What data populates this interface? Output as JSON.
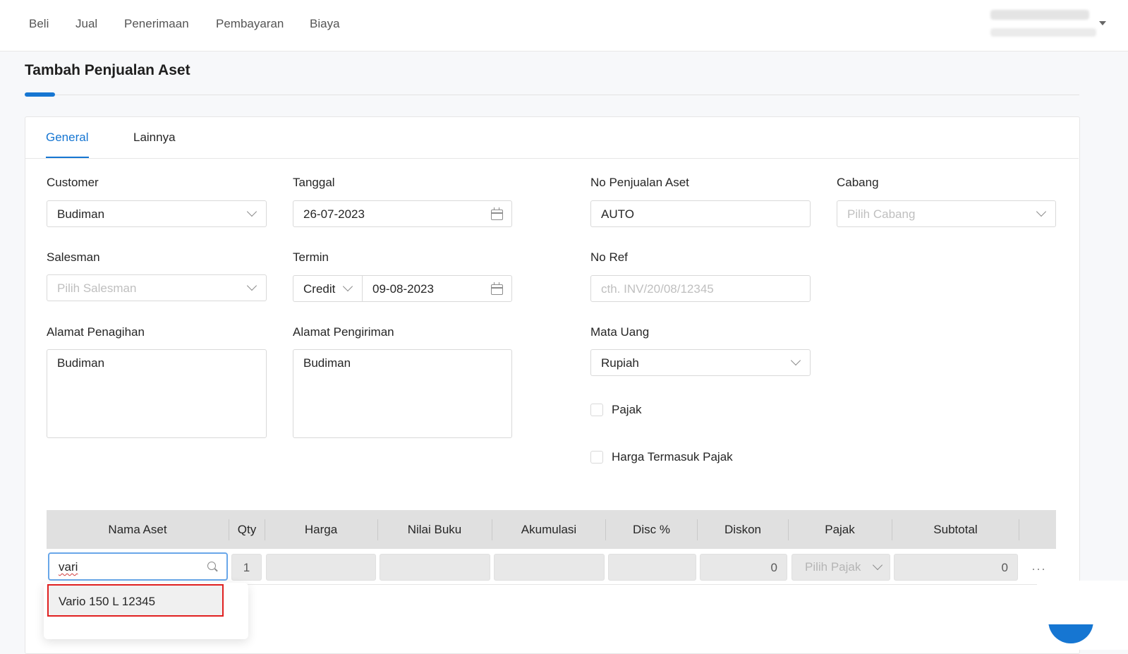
{
  "nav": {
    "items": [
      "Beli",
      "Jual",
      "Penerimaan",
      "Pembayaran",
      "Biaya"
    ]
  },
  "page": {
    "title": "Tambah Penjualan Aset"
  },
  "tabs": [
    "General",
    "Lainnya"
  ],
  "form": {
    "customer": {
      "label": "Customer",
      "value": "Budiman"
    },
    "tanggal": {
      "label": "Tanggal",
      "value": "26-07-2023"
    },
    "no_penjualan": {
      "label": "No Penjualan Aset",
      "value": "AUTO"
    },
    "cabang": {
      "label": "Cabang",
      "placeholder": "Pilih Cabang"
    },
    "salesman": {
      "label": "Salesman",
      "placeholder": "Pilih Salesman"
    },
    "termin": {
      "label": "Termin",
      "type": "Credit",
      "date": "09-08-2023"
    },
    "no_ref": {
      "label": "No Ref",
      "placeholder": "cth. INV/20/08/12345"
    },
    "alamat_penagihan": {
      "label": "Alamat Penagihan",
      "value": "Budiman"
    },
    "alamat_pengiriman": {
      "label": "Alamat Pengiriman",
      "value": "Budiman"
    },
    "mata_uang": {
      "label": "Mata Uang",
      "value": "Rupiah"
    },
    "pajak": {
      "label": "Pajak",
      "checked": false
    },
    "harga_termasuk_pajak": {
      "label": "Harga Termasuk Pajak",
      "checked": false
    }
  },
  "table": {
    "columns": [
      "Nama Aset",
      "Qty",
      "Harga",
      "Nilai Buku",
      "Akumulasi",
      "Disc %",
      "Diskon",
      "Pajak",
      "Subtotal"
    ],
    "row": {
      "search": "vari",
      "qty": "1",
      "harga": "",
      "nilai_buku": "",
      "akumulasi": "",
      "disc_pct": "",
      "diskon": "0",
      "pajak_placeholder": "Pilih Pajak",
      "subtotal": "0"
    },
    "suggestions": [
      "Vario 150 L 12345"
    ]
  },
  "colors": {
    "accent": "#1676d2",
    "highlight": "#e02020"
  },
  "icons": [
    "chevron-down-icon",
    "calendar-icon",
    "search-icon",
    "more-icon",
    "user-caret-icon"
  ]
}
